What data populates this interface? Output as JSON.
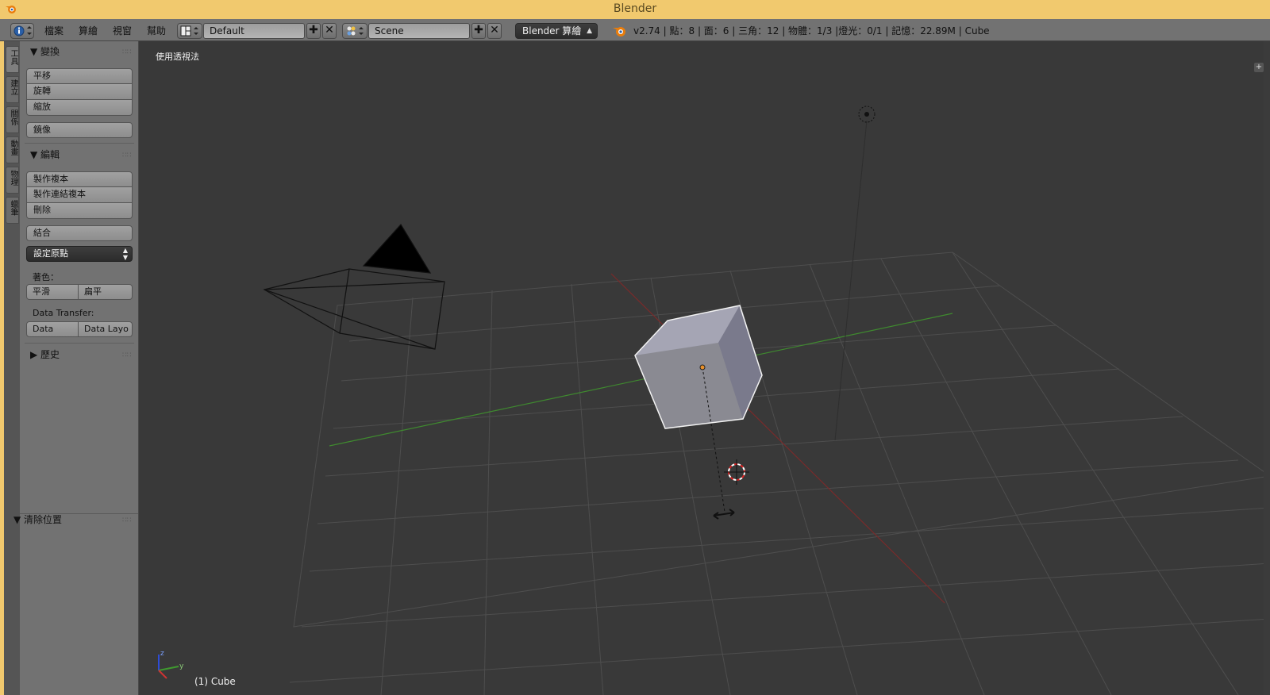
{
  "window": {
    "title": "Blender"
  },
  "menu": [
    "檔案",
    "算繪",
    "視窗",
    "幫助"
  ],
  "screen_layout": {
    "value": "Default"
  },
  "scene": {
    "value": "Scene"
  },
  "render_engine": {
    "value": "Blender 算繪"
  },
  "stats": "v2.74 | 點：8 | 面：6 | 三角：12 | 物體：1/3 |燈光：0/1 | 記憶：22.89M | Cube",
  "tool_tabs": [
    "工具",
    "建立",
    "關係",
    "動畫",
    "物理",
    "蠟筆"
  ],
  "tool_shelf": {
    "transform": {
      "title": "變換",
      "buttons": [
        "平移",
        "旋轉",
        "縮放"
      ],
      "mirror": "鏡像"
    },
    "edit": {
      "title": "編輯",
      "buttons": [
        "製作複本",
        "製作連結複本",
        "刪除"
      ],
      "join": "結合",
      "set_origin": "設定原點"
    },
    "shading": {
      "label": "著色：",
      "smooth": "平滑",
      "flat": "扁平"
    },
    "data_transfer": {
      "label": "Data Transfer:",
      "data": "Data",
      "data_layout": "Data Layo"
    },
    "history": {
      "title": "歷史"
    }
  },
  "operator_panel": {
    "title": "清除位置"
  },
  "viewport": {
    "view_label": "使用透視法",
    "object_label": "(1) Cube",
    "axis_labels": {
      "z": "z",
      "y": "y"
    }
  }
}
